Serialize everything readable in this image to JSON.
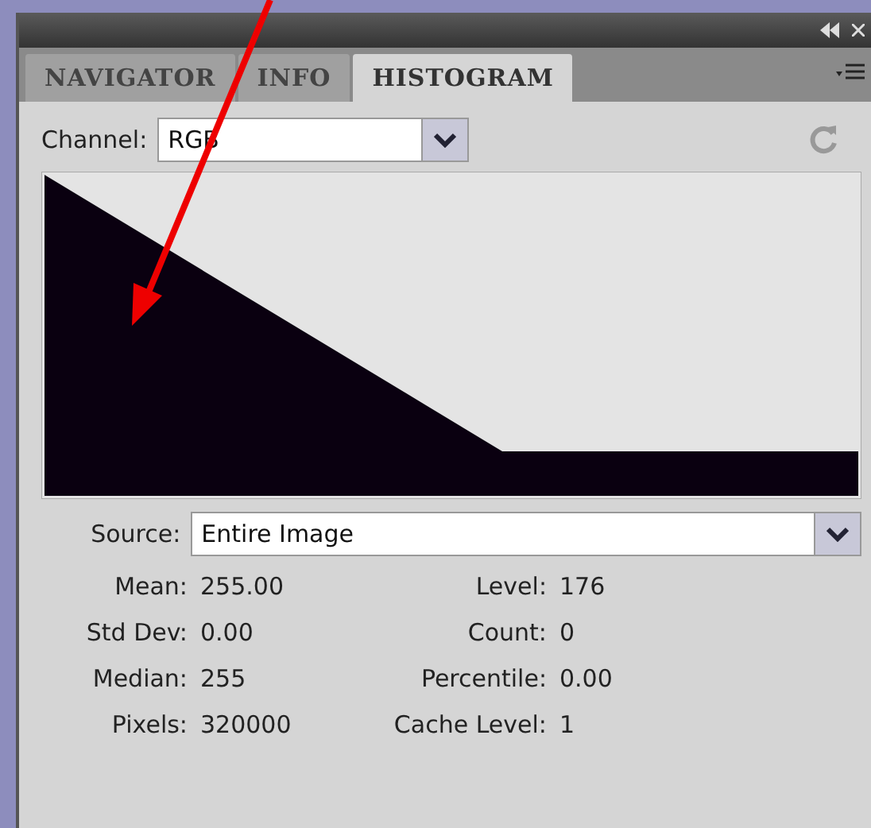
{
  "tabs": [
    {
      "label": "NAVIGATOR",
      "selected": false
    },
    {
      "label": "INFO",
      "selected": false
    },
    {
      "label": "HISTOGRAM",
      "selected": true
    }
  ],
  "channel": {
    "label": "Channel:",
    "value": "RGB"
  },
  "source": {
    "label": "Source:",
    "value": "Entire Image"
  },
  "stats_left": [
    {
      "label": "Mean:",
      "value": "255.00"
    },
    {
      "label": "Std Dev:",
      "value": "0.00"
    },
    {
      "label": "Median:",
      "value": "255"
    },
    {
      "label": "Pixels:",
      "value": "320000"
    }
  ],
  "stats_right": [
    {
      "label": "Level:",
      "value": "176"
    },
    {
      "label": "Count:",
      "value": "0"
    },
    {
      "label": "Percentile:",
      "value": "0.00"
    },
    {
      "label": "Cache Level:",
      "value": "1"
    }
  ]
}
